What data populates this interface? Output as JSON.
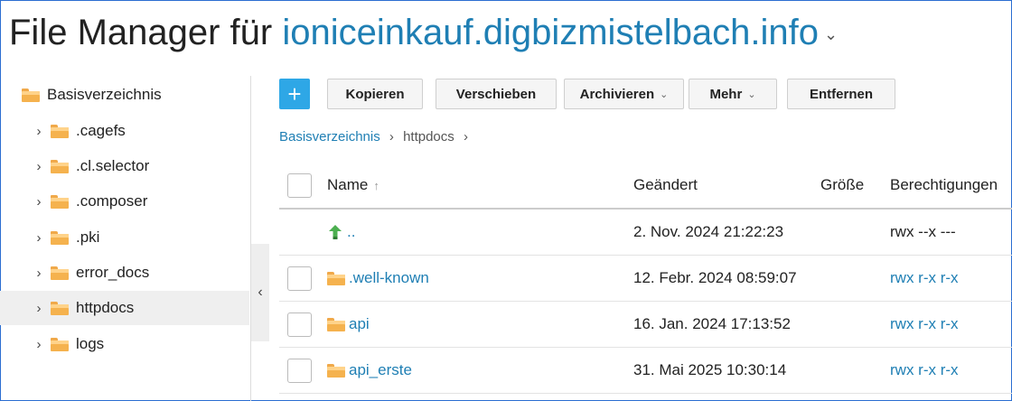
{
  "header": {
    "title_prefix": "File Manager für",
    "domain": "ioniceinkauf.digbizmistelbach.info",
    "caret": "⌄"
  },
  "sidebar": {
    "items": [
      {
        "label": "Basisverzeichnis",
        "chev": ""
      },
      {
        "label": ".cagefs",
        "chev": "›"
      },
      {
        "label": ".cl.selector",
        "chev": "›"
      },
      {
        "label": ".composer",
        "chev": "›"
      },
      {
        "label": ".pki",
        "chev": "›"
      },
      {
        "label": "error_docs",
        "chev": "›"
      },
      {
        "label": "httpdocs",
        "chev": "›"
      },
      {
        "label": "logs",
        "chev": "›"
      }
    ],
    "collapse": "‹"
  },
  "toolbar": {
    "add": "+",
    "copy": "Kopieren",
    "move": "Verschieben",
    "archive": "Archivieren",
    "more": "Mehr",
    "remove": "Entfernen",
    "dd": "⌄"
  },
  "breadcrumb": {
    "root": "Basisverzeichnis",
    "sep": "›",
    "current": "httpdocs"
  },
  "table": {
    "columns": {
      "name": "Name",
      "sort": "↑",
      "modified": "Geändert",
      "size": "Größe",
      "perms": "Berechtigungen"
    },
    "rows": [
      {
        "name": "..",
        "modified": "2. Nov. 2024 21:22:23",
        "size": "",
        "perms": "rwx --x ---"
      },
      {
        "name": ".well-known",
        "modified": "12. Febr. 2024 08:59:07",
        "size": "",
        "perms": "rwx r-x r-x"
      },
      {
        "name": "api",
        "modified": "16. Jan. 2024 17:13:52",
        "size": "",
        "perms": "rwx r-x r-x"
      },
      {
        "name": "api_erste",
        "modified": "31. Mai 2025 10:30:14",
        "size": "",
        "perms": "rwx r-x r-x"
      }
    ]
  },
  "colors": {
    "accent": "#2ea7e6",
    "link": "#1f7fb4",
    "folder": "#f5b24e",
    "up_arrow": "#4caf50"
  }
}
